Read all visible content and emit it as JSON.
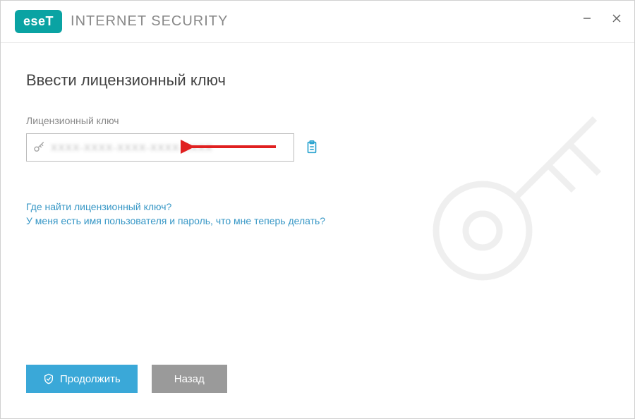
{
  "header": {
    "logo_text": "eseT",
    "product_name": "INTERNET SECURITY"
  },
  "page": {
    "title": "Ввести лицензионный ключ",
    "field_label": "Лицензионный ключ",
    "license_value": "XXXX-XXXX-XXXX-XXXX-XXXX"
  },
  "links": {
    "where_find": "Где найти лицензионный ключ?",
    "have_credentials": "У меня есть имя пользователя и пароль, что мне теперь делать?"
  },
  "buttons": {
    "continue": "Продолжить",
    "back": "Назад"
  },
  "colors": {
    "accent_teal": "#0aa3a3",
    "link_blue": "#3797c6",
    "primary_button": "#3aa8d8",
    "secondary_button": "#9a9a9a"
  }
}
